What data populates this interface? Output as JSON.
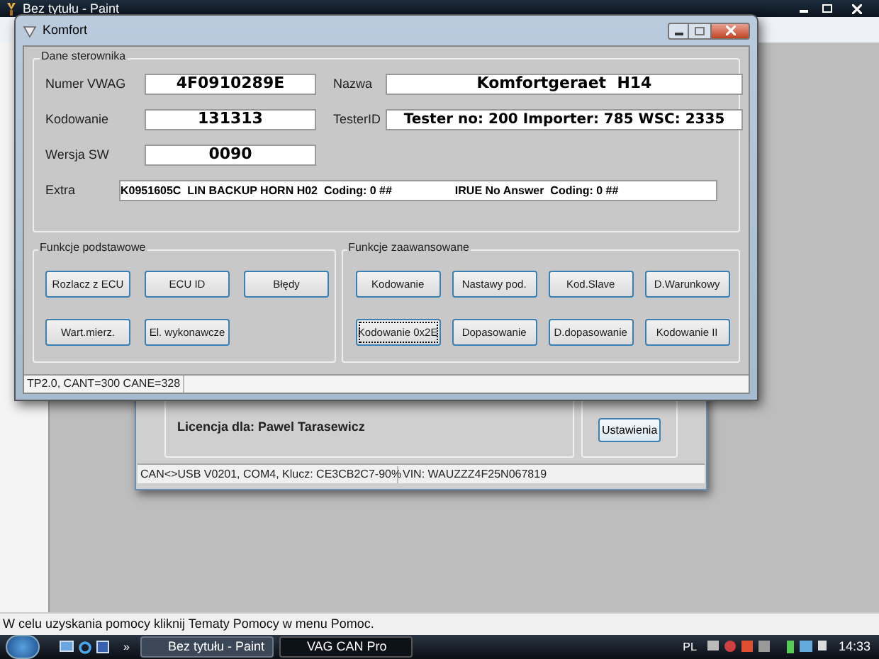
{
  "paint": {
    "title": "Bez tytułu - Paint",
    "status": "W celu uzyskania pomocy kliknij Tematy Pomocy w menu Pomoc."
  },
  "vag": {
    "license": "Licencja dla: Pawel Tarasewicz",
    "settings_button": "Ustawienia",
    "status": [
      "CAN<>USB V0201, COM4, Klucz: CE3CB2C7-90%",
      "VIN: WAUZZZ4F25N067819"
    ]
  },
  "komfort": {
    "title": "Komfort",
    "group_title": "Dane sterownika",
    "fields": [
      {
        "label": "Numer VWAG",
        "value": "4F0910289E"
      },
      {
        "label": "Nazwa",
        "value": "Komfortgeraet  H14"
      },
      {
        "label": "Kodowanie",
        "value": "131313"
      },
      {
        "label": "TesterID",
        "value": "Tester no: 200 Importer: 785 WSC: 2335"
      },
      {
        "label": "Wersja SW",
        "value": "0090"
      }
    ],
    "extra": {
      "label": "Extra",
      "value": "K0951605C  LIN BACKUP HORN H02  Coding: 0 ##                    IRUE No Answer  Coding: 0 ##"
    },
    "basic": {
      "title": "Funkcje podstawowe",
      "buttons": [
        {
          "label": "Rozlacz z ECU",
          "focused": false
        },
        {
          "label": "ECU ID",
          "focused": false
        },
        {
          "label": "Błędy",
          "focused": false
        },
        {
          "label": "Wart.mierz.",
          "focused": false
        },
        {
          "label": "El. wykonawcze",
          "focused": false
        }
      ]
    },
    "advanced": {
      "title": "Funkcje zaawansowane",
      "buttons": [
        {
          "label": "Kodowanie",
          "focused": false
        },
        {
          "label": "Nastawy pod.",
          "focused": false
        },
        {
          "label": "Kod.Slave",
          "focused": false
        },
        {
          "label": "D.Warunkowy",
          "focused": false
        },
        {
          "label": "Kodowanie 0x2E",
          "focused": true
        },
        {
          "label": "Dopasowanie",
          "focused": false
        },
        {
          "label": "D.dopasowanie",
          "focused": false
        },
        {
          "label": "Kodowanie II",
          "focused": false
        }
      ]
    },
    "status": "TP2.0, CANT=300 CANE=328"
  },
  "taskbar": {
    "overflow": "»",
    "tasks": [
      {
        "label": "Bez tytułu - Paint",
        "selected": false
      },
      {
        "label": "VAG CAN Pro",
        "selected": true
      }
    ],
    "language": "PL",
    "clock": "14:33"
  }
}
